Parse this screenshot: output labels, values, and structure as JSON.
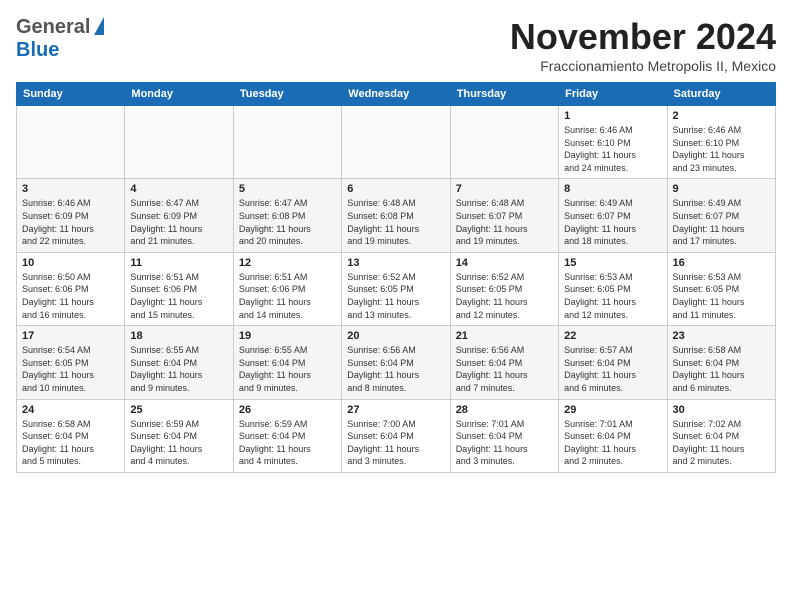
{
  "logo": {
    "line1": "General",
    "line2": "Blue"
  },
  "title": "November 2024",
  "location": "Fraccionamiento Metropolis II, Mexico",
  "weekdays": [
    "Sunday",
    "Monday",
    "Tuesday",
    "Wednesday",
    "Thursday",
    "Friday",
    "Saturday"
  ],
  "weeks": [
    [
      {
        "day": "",
        "info": ""
      },
      {
        "day": "",
        "info": ""
      },
      {
        "day": "",
        "info": ""
      },
      {
        "day": "",
        "info": ""
      },
      {
        "day": "",
        "info": ""
      },
      {
        "day": "1",
        "info": "Sunrise: 6:46 AM\nSunset: 6:10 PM\nDaylight: 11 hours\nand 24 minutes."
      },
      {
        "day": "2",
        "info": "Sunrise: 6:46 AM\nSunset: 6:10 PM\nDaylight: 11 hours\nand 23 minutes."
      }
    ],
    [
      {
        "day": "3",
        "info": "Sunrise: 6:46 AM\nSunset: 6:09 PM\nDaylight: 11 hours\nand 22 minutes."
      },
      {
        "day": "4",
        "info": "Sunrise: 6:47 AM\nSunset: 6:09 PM\nDaylight: 11 hours\nand 21 minutes."
      },
      {
        "day": "5",
        "info": "Sunrise: 6:47 AM\nSunset: 6:08 PM\nDaylight: 11 hours\nand 20 minutes."
      },
      {
        "day": "6",
        "info": "Sunrise: 6:48 AM\nSunset: 6:08 PM\nDaylight: 11 hours\nand 19 minutes."
      },
      {
        "day": "7",
        "info": "Sunrise: 6:48 AM\nSunset: 6:07 PM\nDaylight: 11 hours\nand 19 minutes."
      },
      {
        "day": "8",
        "info": "Sunrise: 6:49 AM\nSunset: 6:07 PM\nDaylight: 11 hours\nand 18 minutes."
      },
      {
        "day": "9",
        "info": "Sunrise: 6:49 AM\nSunset: 6:07 PM\nDaylight: 11 hours\nand 17 minutes."
      }
    ],
    [
      {
        "day": "10",
        "info": "Sunrise: 6:50 AM\nSunset: 6:06 PM\nDaylight: 11 hours\nand 16 minutes."
      },
      {
        "day": "11",
        "info": "Sunrise: 6:51 AM\nSunset: 6:06 PM\nDaylight: 11 hours\nand 15 minutes."
      },
      {
        "day": "12",
        "info": "Sunrise: 6:51 AM\nSunset: 6:06 PM\nDaylight: 11 hours\nand 14 minutes."
      },
      {
        "day": "13",
        "info": "Sunrise: 6:52 AM\nSunset: 6:05 PM\nDaylight: 11 hours\nand 13 minutes."
      },
      {
        "day": "14",
        "info": "Sunrise: 6:52 AM\nSunset: 6:05 PM\nDaylight: 11 hours\nand 12 minutes."
      },
      {
        "day": "15",
        "info": "Sunrise: 6:53 AM\nSunset: 6:05 PM\nDaylight: 11 hours\nand 12 minutes."
      },
      {
        "day": "16",
        "info": "Sunrise: 6:53 AM\nSunset: 6:05 PM\nDaylight: 11 hours\nand 11 minutes."
      }
    ],
    [
      {
        "day": "17",
        "info": "Sunrise: 6:54 AM\nSunset: 6:05 PM\nDaylight: 11 hours\nand 10 minutes."
      },
      {
        "day": "18",
        "info": "Sunrise: 6:55 AM\nSunset: 6:04 PM\nDaylight: 11 hours\nand 9 minutes."
      },
      {
        "day": "19",
        "info": "Sunrise: 6:55 AM\nSunset: 6:04 PM\nDaylight: 11 hours\nand 9 minutes."
      },
      {
        "day": "20",
        "info": "Sunrise: 6:56 AM\nSunset: 6:04 PM\nDaylight: 11 hours\nand 8 minutes."
      },
      {
        "day": "21",
        "info": "Sunrise: 6:56 AM\nSunset: 6:04 PM\nDaylight: 11 hours\nand 7 minutes."
      },
      {
        "day": "22",
        "info": "Sunrise: 6:57 AM\nSunset: 6:04 PM\nDaylight: 11 hours\nand 6 minutes."
      },
      {
        "day": "23",
        "info": "Sunrise: 6:58 AM\nSunset: 6:04 PM\nDaylight: 11 hours\nand 6 minutes."
      }
    ],
    [
      {
        "day": "24",
        "info": "Sunrise: 6:58 AM\nSunset: 6:04 PM\nDaylight: 11 hours\nand 5 minutes."
      },
      {
        "day": "25",
        "info": "Sunrise: 6:59 AM\nSunset: 6:04 PM\nDaylight: 11 hours\nand 4 minutes."
      },
      {
        "day": "26",
        "info": "Sunrise: 6:59 AM\nSunset: 6:04 PM\nDaylight: 11 hours\nand 4 minutes."
      },
      {
        "day": "27",
        "info": "Sunrise: 7:00 AM\nSunset: 6:04 PM\nDaylight: 11 hours\nand 3 minutes."
      },
      {
        "day": "28",
        "info": "Sunrise: 7:01 AM\nSunset: 6:04 PM\nDaylight: 11 hours\nand 3 minutes."
      },
      {
        "day": "29",
        "info": "Sunrise: 7:01 AM\nSunset: 6:04 PM\nDaylight: 11 hours\nand 2 minutes."
      },
      {
        "day": "30",
        "info": "Sunrise: 7:02 AM\nSunset: 6:04 PM\nDaylight: 11 hours\nand 2 minutes."
      }
    ]
  ]
}
